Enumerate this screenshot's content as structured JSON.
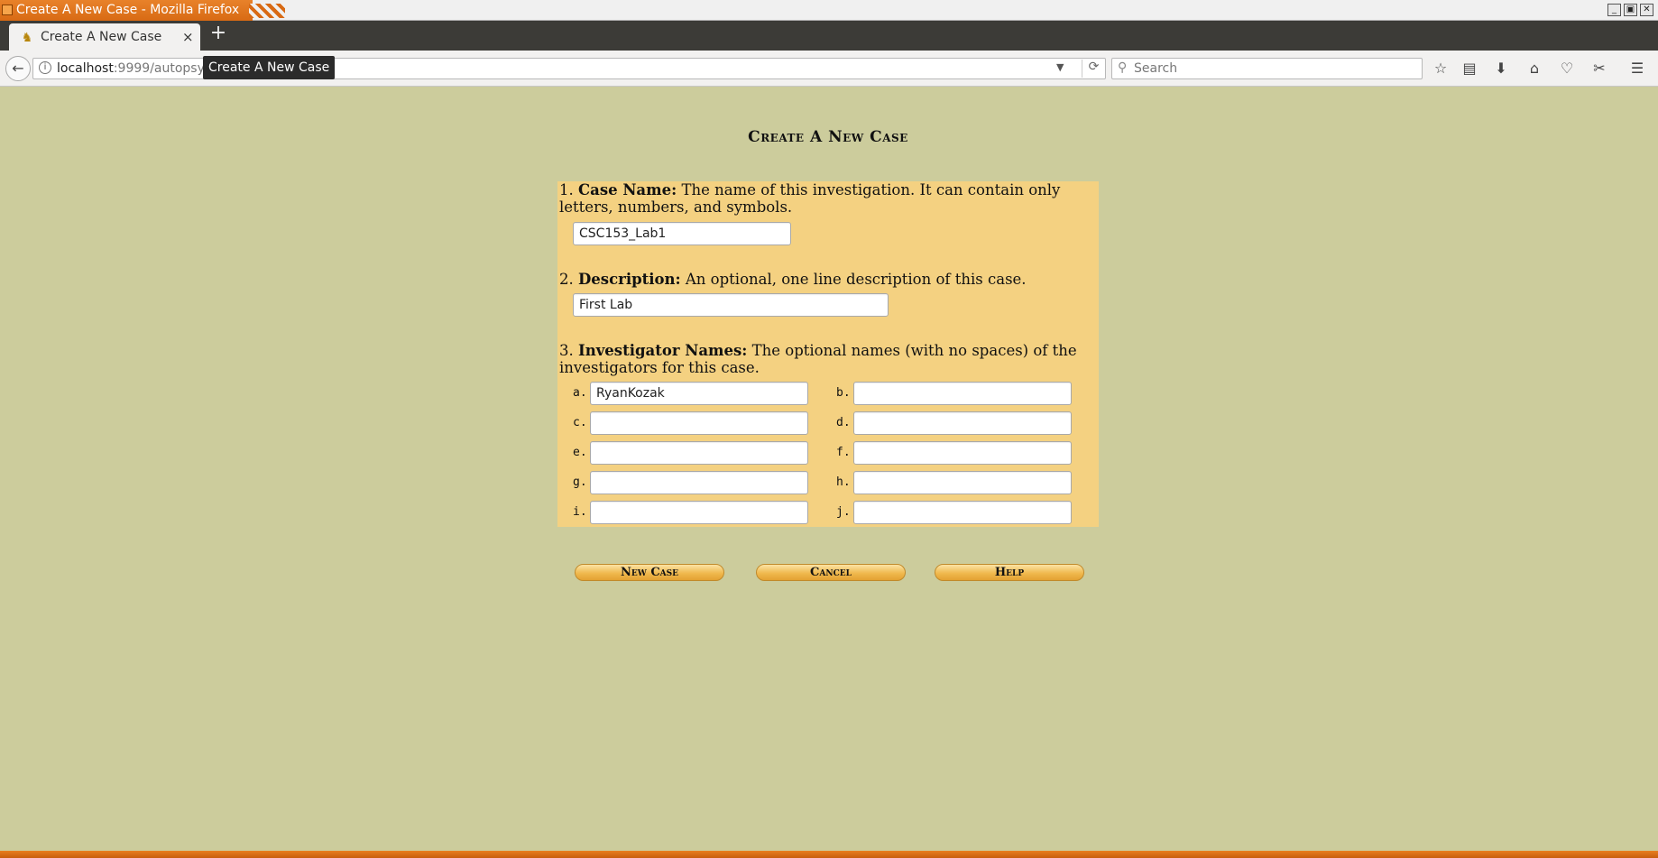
{
  "window": {
    "title": "Create A New Case - Mozilla Firefox",
    "controls": [
      "_",
      "▣",
      "✕"
    ]
  },
  "tabs": [
    {
      "label": "Create A New Case",
      "close": "×"
    }
  ],
  "newtab_label": "+",
  "nav": {
    "back": "←",
    "url_host": "localhost",
    "url_rest": ":9999/autopsy",
    "tooltip": "Create A New Case",
    "search_placeholder": "Search",
    "icons": [
      "star-icon",
      "reading-list-icon",
      "download-icon",
      "home-icon",
      "pocket-icon",
      "extension-icon",
      "menu-icon"
    ]
  },
  "page": {
    "title": "Create A New Case",
    "q1": {
      "num": "1.",
      "label": "Case Name:",
      "text": "The name of this investigation. It can contain only letters, numbers, and symbols.",
      "value": "CSC153_Lab1"
    },
    "q2": {
      "num": "2.",
      "label": "Description:",
      "text": "An optional, one line description of this case.",
      "value": "First Lab"
    },
    "q3": {
      "num": "3.",
      "label": "Investigator Names:",
      "text": "The optional names (with no spaces) of the investigators for this case.",
      "investigators": [
        {
          "letter": "a.",
          "value": "RyanKozak"
        },
        {
          "letter": "b.",
          "value": ""
        },
        {
          "letter": "c.",
          "value": ""
        },
        {
          "letter": "d.",
          "value": ""
        },
        {
          "letter": "e.",
          "value": ""
        },
        {
          "letter": "f.",
          "value": ""
        },
        {
          "letter": "g.",
          "value": ""
        },
        {
          "letter": "h.",
          "value": ""
        },
        {
          "letter": "i.",
          "value": ""
        },
        {
          "letter": "j.",
          "value": ""
        }
      ]
    },
    "buttons": {
      "new_case": "New Case",
      "cancel": "Cancel",
      "help": "Help"
    }
  }
}
